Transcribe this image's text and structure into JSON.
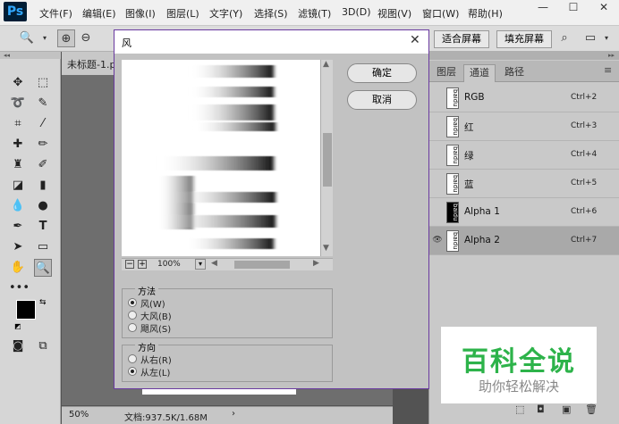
{
  "app": {
    "logo": "Ps"
  },
  "menu": [
    "文件(F)",
    "编辑(E)",
    "图像(I)",
    "图层(L)",
    "文字(Y)",
    "选择(S)",
    "滤镜(T)",
    "3D(D)",
    "视图(V)",
    "窗口(W)",
    "帮助(H)"
  ],
  "options_bar": {
    "fit_screen": "适合屏幕",
    "fill_screen": "填充屏幕"
  },
  "document": {
    "tab_title": "未标题-1.p",
    "zoom": "50%",
    "doc_info": "文档:937.5K/1.68M"
  },
  "panel": {
    "tabs": [
      "图层",
      "通道",
      "路径"
    ],
    "active_tab": 1,
    "channels": [
      {
        "name": "RGB",
        "shortcut": "Ctrl+2"
      },
      {
        "name": "红",
        "shortcut": "Ctrl+3"
      },
      {
        "name": "绿",
        "shortcut": "Ctrl+4"
      },
      {
        "name": "蓝",
        "shortcut": "Ctrl+5"
      },
      {
        "name": "Alpha 1",
        "shortcut": "Ctrl+6"
      },
      {
        "name": "Alpha 2",
        "shortcut": "Ctrl+7"
      }
    ],
    "thumb_text": "baidu"
  },
  "dialog": {
    "title": "风",
    "ok": "确定",
    "cancel": "取消",
    "zoom": "100%",
    "method_label": "方法",
    "methods": [
      "风(W)",
      "大风(B)",
      "飓风(S)"
    ],
    "selected_method": 0,
    "direction_label": "方向",
    "directions": [
      "从右(R)",
      "从左(L)"
    ],
    "selected_direction": 1
  },
  "watermark": {
    "title": "百科全说",
    "subtitle": "助你轻松解决",
    "title_color": "#2db34a"
  }
}
